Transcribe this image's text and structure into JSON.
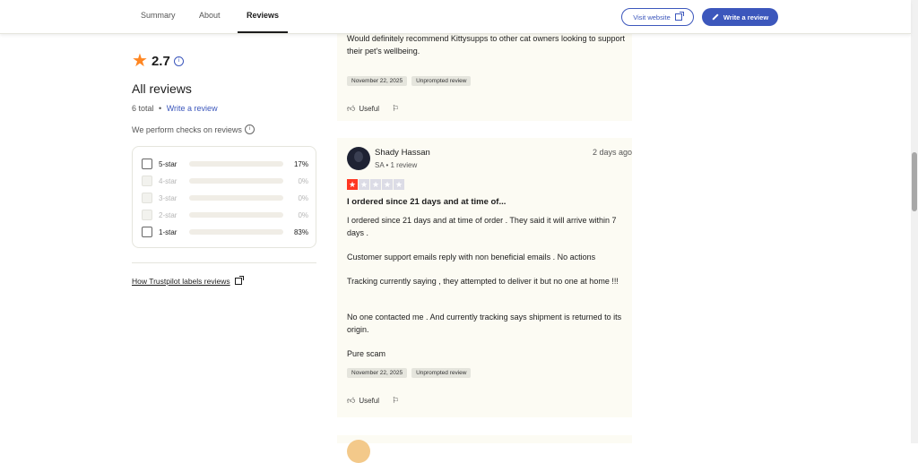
{
  "nav": {
    "tabs": [
      {
        "label": "Summary"
      },
      {
        "label": "About"
      },
      {
        "label": "Reviews"
      }
    ],
    "visit_website": "Visit website",
    "write_review": "Write a review"
  },
  "summary": {
    "rating": "2.7",
    "title": "All reviews",
    "total": "6 total",
    "separator": "•",
    "write_link": "Write a review",
    "checks": "We perform checks on reviews",
    "filters": [
      {
        "label": "5-star",
        "percent_text": "17%",
        "percent": 17
      },
      {
        "label": "4-star",
        "percent_text": "0%",
        "percent": 0
      },
      {
        "label": "3-star",
        "percent_text": "0%",
        "percent": 0
      },
      {
        "label": "2-star",
        "percent_text": "0%",
        "percent": 0
      },
      {
        "label": "1-star",
        "percent_text": "83%",
        "percent": 83
      }
    ],
    "labels_link": "How Trustpilot labels reviews"
  },
  "reviews": [
    {
      "text": "Would definitely recommend Kittysupps to other cat owners looking to support their pet's wellbeing.",
      "tags": [
        "November 22, 2025",
        "Unprompted review"
      ],
      "useful": "Useful"
    },
    {
      "name": "Shady Hassan",
      "meta": "SA • 1 review",
      "date": "2 days ago",
      "stars": 1,
      "title": "I ordered since 21 days and at time of...",
      "paragraphs": [
        "I ordered since 21 days and at time of order . They said it will arrive within 7 days .",
        "Customer support emails reply with non beneficial emails . No actions",
        "Tracking currently saying , they attempted to deliver it but no one at home !!!",
        "No one contacted me . And currently tracking says shipment is returned to its origin.",
        "Pure scam"
      ],
      "tags": [
        "November 22, 2025",
        "Unprompted review"
      ],
      "useful": "Useful"
    }
  ],
  "colors": {
    "accent": "#3c57bc",
    "star_orange": "#ff8622",
    "star_red": "#ff3722",
    "card_bg": "#fcfbf3"
  },
  "icons": [
    "star-icon",
    "info-icon",
    "external-link-icon",
    "pencil-icon",
    "thumbs-up-icon",
    "flag-icon"
  ]
}
